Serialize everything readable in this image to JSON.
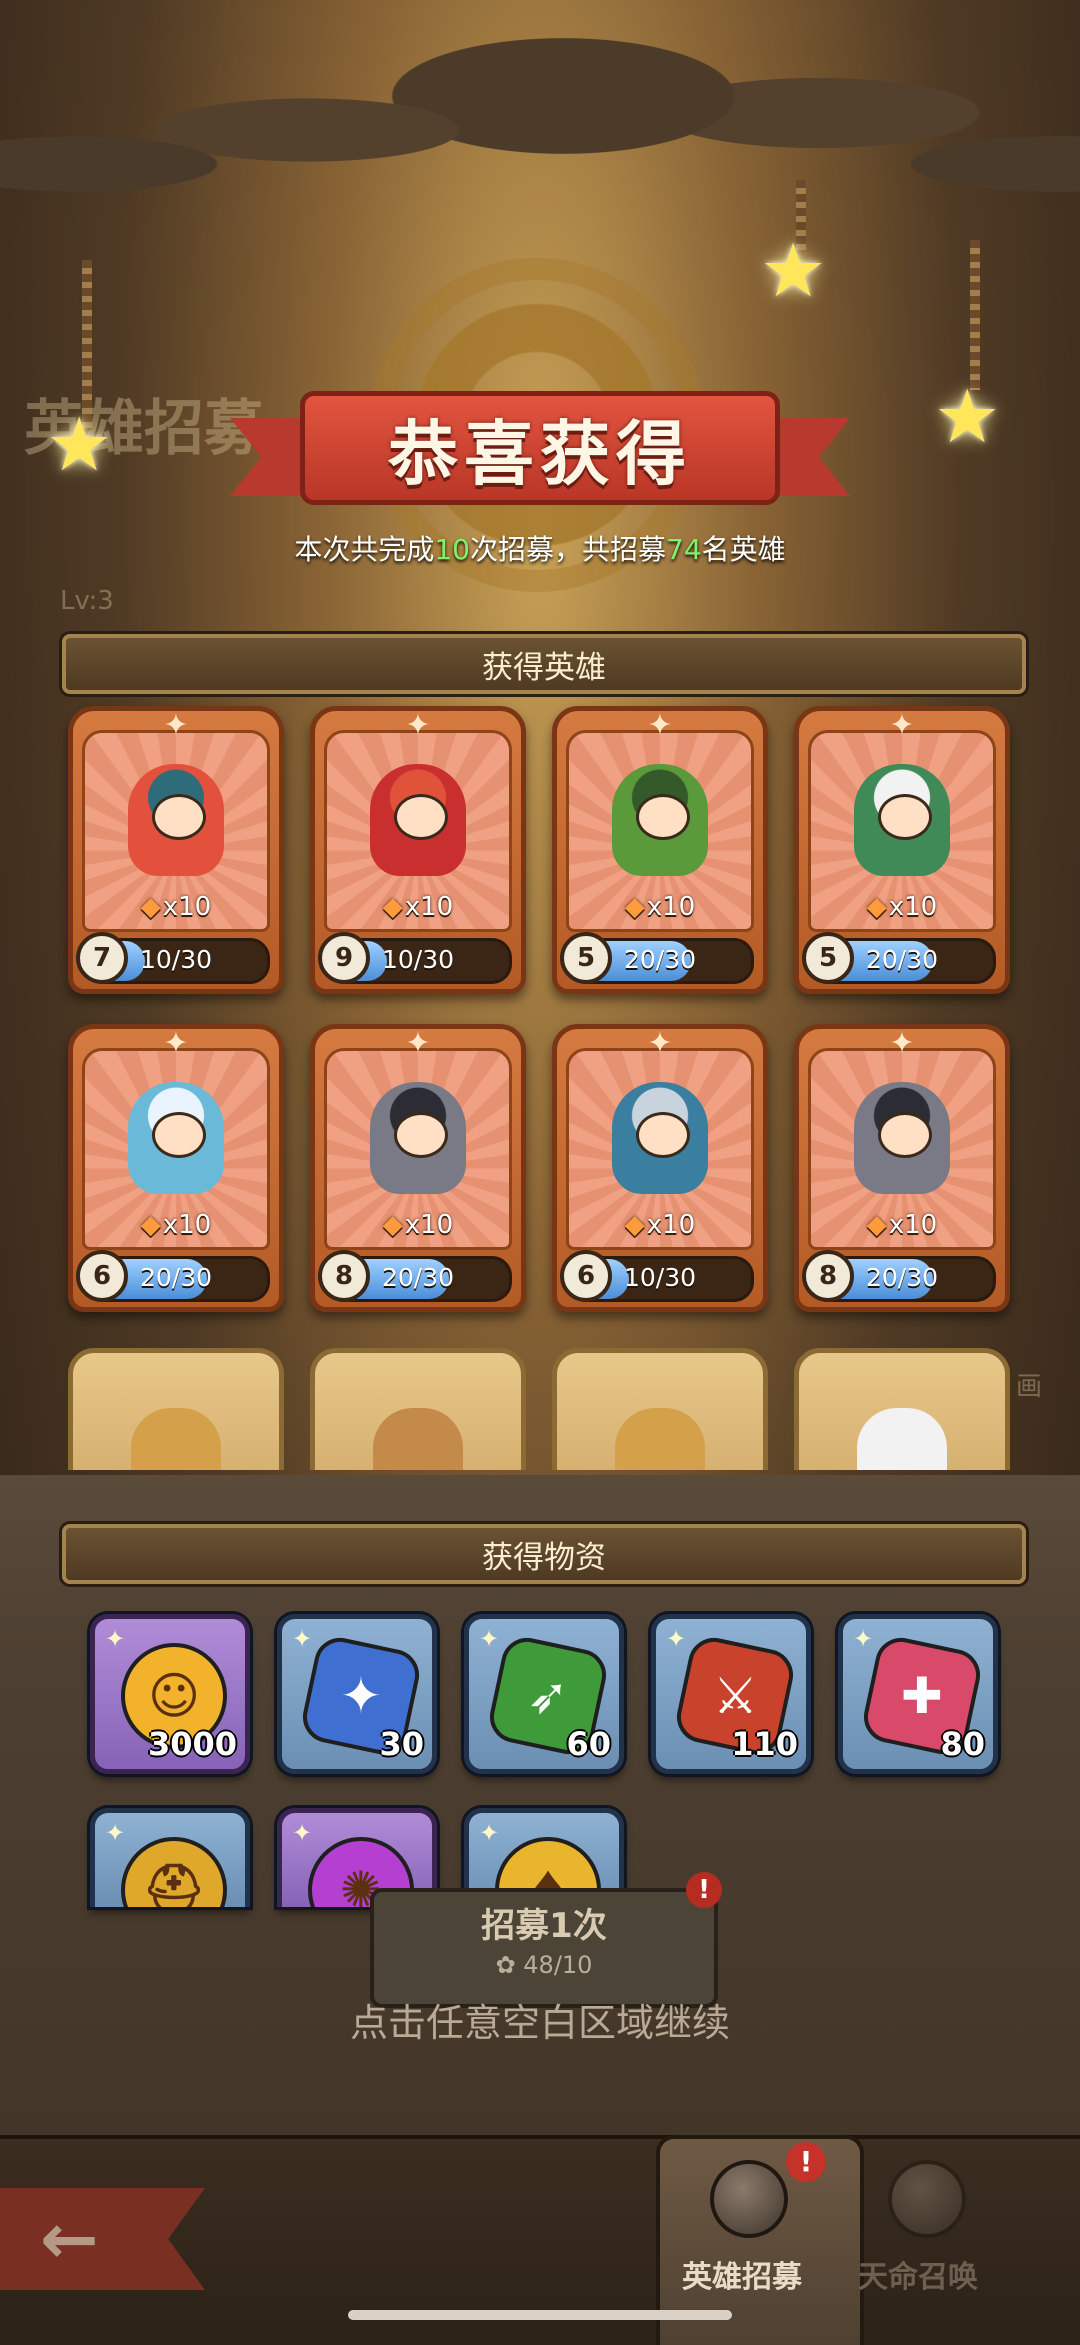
{
  "title": "恭喜获得",
  "summary": {
    "prefix": "本次共完成",
    "recruits": "10",
    "mid": "次招募，共招募",
    "heroes": "74",
    "suffix": "名英雄"
  },
  "sections": {
    "heroes": "获得英雄",
    "items": "获得物资"
  },
  "hero_cards": [
    {
      "level": "7",
      "count": "x10",
      "progress": "10/30",
      "progress_fraction": 0.33,
      "color": "#e3503c",
      "hat": "#2f6c7a"
    },
    {
      "level": "9",
      "count": "x10",
      "progress": "10/30",
      "progress_fraction": 0.33,
      "color": "#c92f2f",
      "hat": "#e0523a"
    },
    {
      "level": "5",
      "count": "x10",
      "progress": "20/30",
      "progress_fraction": 0.67,
      "color": "#5a9a3b",
      "hat": "#355a2a"
    },
    {
      "level": "5",
      "count": "x10",
      "progress": "20/30",
      "progress_fraction": 0.67,
      "color": "#3f8a56",
      "hat": "#f2f2f2"
    },
    {
      "level": "6",
      "count": "x10",
      "progress": "20/30",
      "progress_fraction": 0.67,
      "color": "#6ab9d9",
      "hat": "#e9f4ff"
    },
    {
      "level": "8",
      "count": "x10",
      "progress": "20/30",
      "progress_fraction": 0.67,
      "color": "#7a7a86",
      "hat": "#2c2c34"
    },
    {
      "level": "6",
      "count": "x10",
      "progress": "10/30",
      "progress_fraction": 0.33,
      "color": "#3a7ea0",
      "hat": "#c9d3de"
    },
    {
      "level": "8",
      "count": "x10",
      "progress": "20/30",
      "progress_fraction": 0.67,
      "color": "#7a7a86",
      "hat": "#2c2c34"
    }
  ],
  "partial_cards": [
    {
      "color": "#d4a14a"
    },
    {
      "color": "#c48a4a"
    },
    {
      "color": "#d4a14a"
    },
    {
      "color": "#f2f2f2"
    }
  ],
  "items": [
    {
      "qty": "3000",
      "icon": "gold-coin-icon",
      "bg": "purple",
      "color": "#f2b22c",
      "glyph": "☺",
      "round": true
    },
    {
      "qty": "30",
      "icon": "mage-shard-icon",
      "bg": "blue",
      "color": "#3f6fd1",
      "glyph": "✦",
      "round": false
    },
    {
      "qty": "60",
      "icon": "archer-shard-icon",
      "bg": "blue",
      "color": "#3f9b3a",
      "glyph": "➶",
      "round": false
    },
    {
      "qty": "110",
      "icon": "warrior-shard-icon",
      "bg": "blue",
      "color": "#c8422c",
      "glyph": "⚔",
      "round": false
    },
    {
      "qty": "80",
      "icon": "healer-shard-icon",
      "bg": "blue",
      "color": "#d94a6a",
      "glyph": "✚",
      "round": false
    }
  ],
  "items_row2": [
    {
      "icon": "helmet-coin-icon",
      "bg": "blue",
      "color": "#e0a82a",
      "glyph": "⛑",
      "round": true
    },
    {
      "icon": "purple-orb-icon",
      "bg": "purple",
      "color": "#b53fd0",
      "glyph": "✺",
      "round": true
    },
    {
      "icon": "spade-coin-icon",
      "bg": "blue",
      "color": "#e8b52c",
      "glyph": "♠",
      "round": true
    }
  ],
  "recruit_button": {
    "label": "招募1次",
    "cost": "48/10",
    "badge": "!"
  },
  "continue_hint": "点击任意空白区域继续",
  "tabs": [
    {
      "label": "英雄招募",
      "active": true
    },
    {
      "label": "天命召唤",
      "active": false
    }
  ],
  "back_glyph": "←",
  "background_text": {
    "left_title": "英雄招募",
    "level": "Lv:3",
    "right": "画"
  }
}
